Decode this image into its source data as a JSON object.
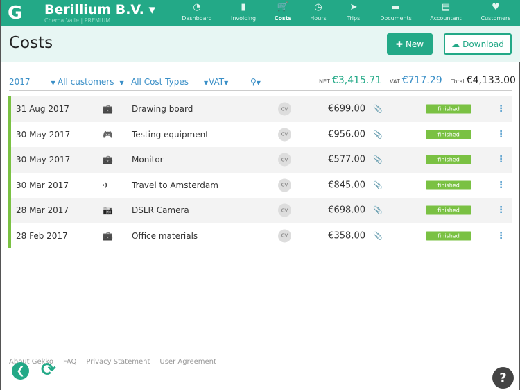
{
  "header": {
    "company": "Berillium B.V.",
    "user": "Chema Valle | PREMIUM",
    "nav": [
      {
        "label": "Dashboard",
        "icon": "◔"
      },
      {
        "label": "Invoicing",
        "icon": "▮"
      },
      {
        "label": "Costs",
        "icon": "🛒"
      },
      {
        "label": "Hours",
        "icon": "◷"
      },
      {
        "label": "Trips",
        "icon": "➤"
      },
      {
        "label": "Documents",
        "icon": "▬"
      },
      {
        "label": "Accountant",
        "icon": "▤"
      },
      {
        "label": "Customers",
        "icon": "♥"
      }
    ]
  },
  "page": {
    "title": "Costs",
    "new_label": "New",
    "download_label": "Download"
  },
  "filters": {
    "year": "2017",
    "customers": "All customers",
    "types": "All Cost Types",
    "vat": "VAT"
  },
  "totals": {
    "net_label": "NET",
    "net": "€3,415.71",
    "vat_label": "VAT",
    "vat": "€717.29",
    "total_label": "Total",
    "total": "€4,133.00"
  },
  "rows": [
    {
      "date": "31 Aug 2017",
      "icon": "briefcase",
      "desc": "Drawing board",
      "cv": "CV",
      "amount": "€699.00",
      "status": "finished"
    },
    {
      "date": "30 May 2017",
      "icon": "gamepad",
      "desc": "Testing equipment",
      "cv": "CV",
      "amount": "€956.00",
      "status": "finished"
    },
    {
      "date": "30 May 2017",
      "icon": "briefcase",
      "desc": "Monitor",
      "cv": "CV",
      "amount": "€577.00",
      "status": "finished"
    },
    {
      "date": "30 Mar 2017",
      "icon": "plane",
      "desc": "Travel to Amsterdam",
      "cv": "CV",
      "amount": "€845.00",
      "status": "finished"
    },
    {
      "date": "28 Mar 2017",
      "icon": "camera",
      "desc": "DSLR Camera",
      "cv": "CV",
      "amount": "€698.00",
      "status": "finished"
    },
    {
      "date": "28 Feb 2017",
      "icon": "briefcase",
      "desc": "Office materials",
      "cv": "CV",
      "amount": "€358.00",
      "status": "finished"
    }
  ],
  "footer": [
    "About Gekko",
    "FAQ",
    "Privacy Statement",
    "User Agreement"
  ],
  "help": "?"
}
